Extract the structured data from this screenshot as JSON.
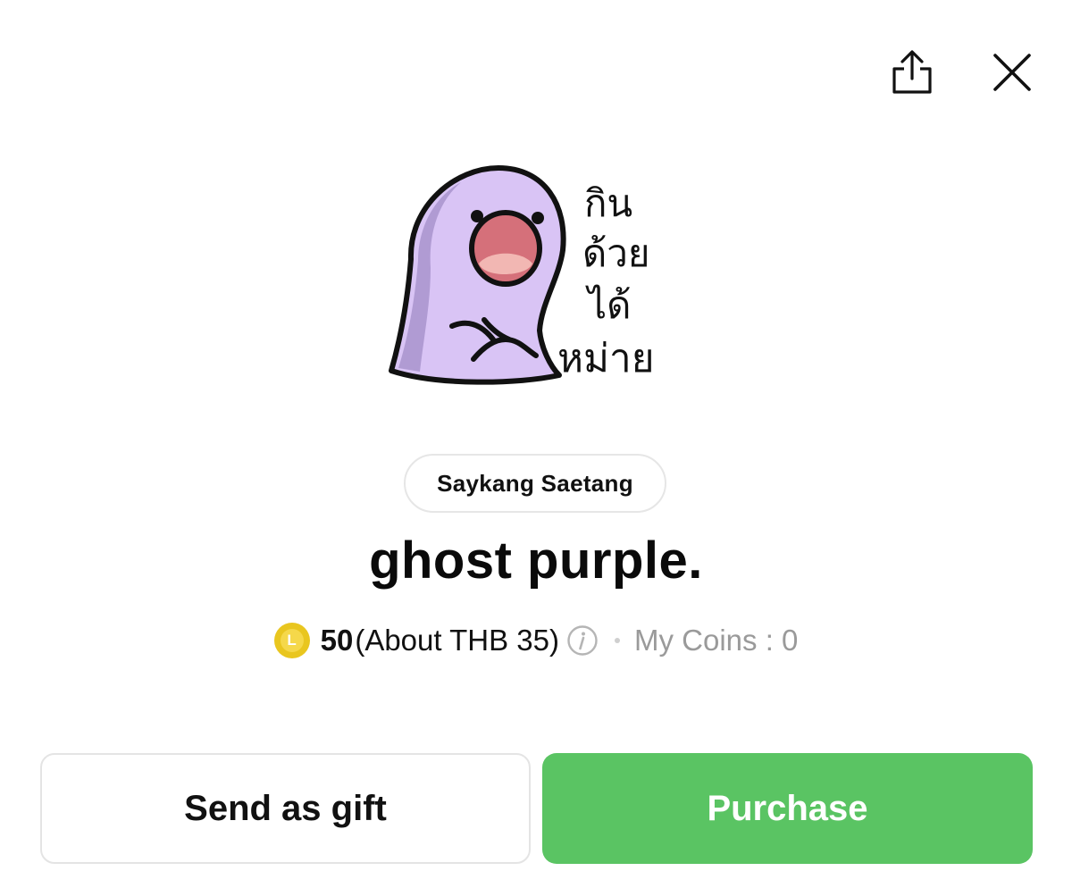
{
  "header": {
    "share_icon": "share-icon",
    "close_icon": "close-icon"
  },
  "sticker": {
    "text_lines": [
      "กิน",
      "ด้วย",
      "ได้",
      "หม่าย"
    ],
    "body_color": "#d9c4f5",
    "shadow_color": "#a894cc"
  },
  "author": {
    "name": "Saykang Saetang"
  },
  "product": {
    "title": "ghost purple."
  },
  "price": {
    "coin_letter": "L",
    "amount": "50",
    "about": "(About THB 35)",
    "my_coins": "My Coins : 0"
  },
  "actions": {
    "gift_label": "Send as gift",
    "purchase_label": "Purchase"
  },
  "colors": {
    "accent_green": "#5ac463",
    "coin_gold": "#e9c61f"
  }
}
